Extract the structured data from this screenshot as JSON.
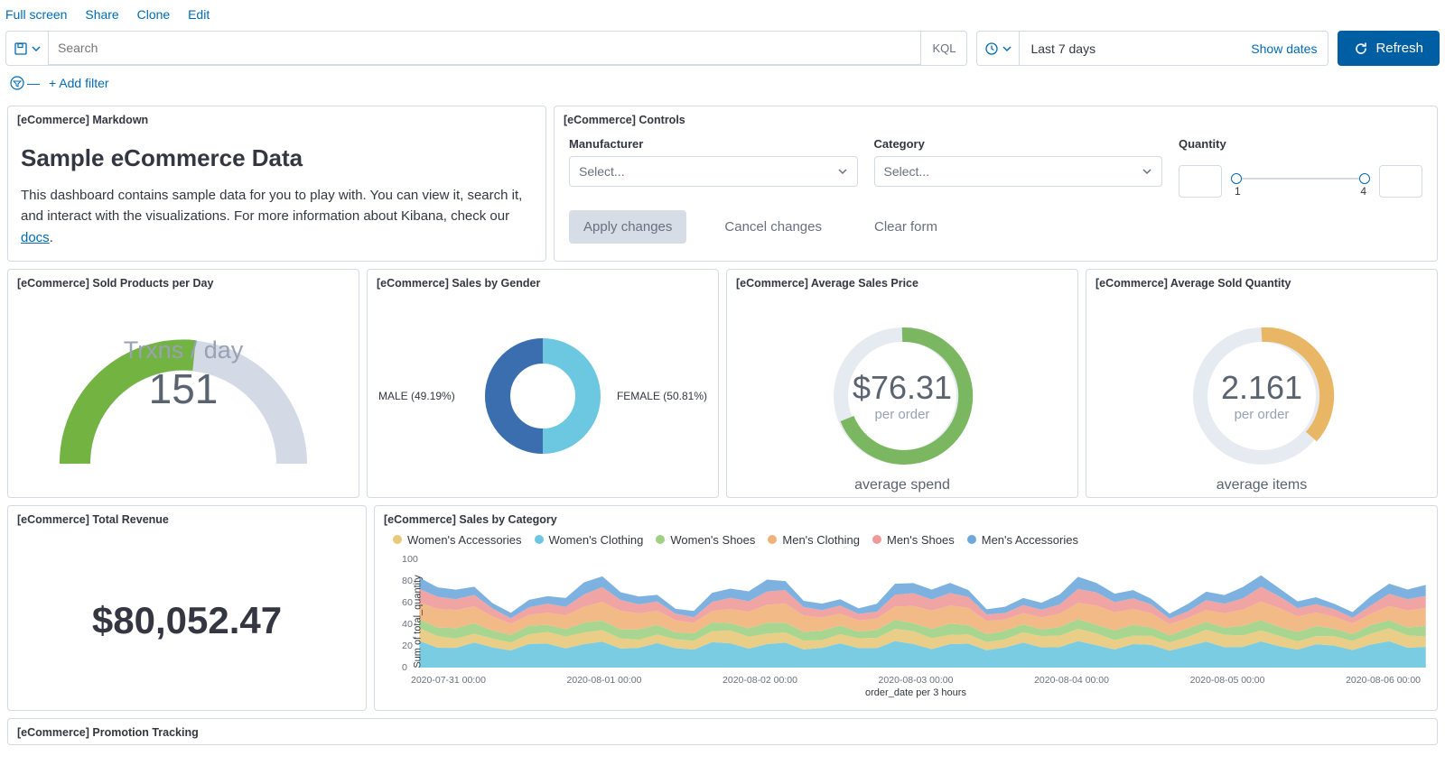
{
  "toolbar": {
    "links": [
      "Full screen",
      "Share",
      "Clone",
      "Edit"
    ],
    "search_placeholder": "Search",
    "kql": "KQL",
    "date_range": "Last 7 days",
    "show_dates": "Show dates",
    "refresh": "Refresh",
    "add_filter": "+ Add filter"
  },
  "panels": {
    "markdown": {
      "title": "[eCommerce] Markdown",
      "heading": "Sample eCommerce Data",
      "body_pre": "This dashboard contains sample data for you to play with. You can view it, search it, and interact with the visualizations. For more information about Kibana, check our ",
      "body_link": "docs",
      "body_post": "."
    },
    "controls": {
      "title": "[eCommerce] Controls",
      "manufacturer_label": "Manufacturer",
      "category_label": "Category",
      "quantity_label": "Quantity",
      "select_placeholder": "Select...",
      "range_min": "1",
      "range_max": "4",
      "apply": "Apply changes",
      "cancel": "Cancel changes",
      "clear": "Clear form"
    },
    "gauge": {
      "title": "[eCommerce] Sold Products per Day",
      "label": "Trxns / day",
      "value": "151"
    },
    "gender": {
      "title": "[eCommerce] Sales by Gender",
      "male_label": "MALE (49.19%)",
      "female_label": "FEMALE (50.81%)"
    },
    "avg_price": {
      "title": "[eCommerce] Average Sales Price",
      "value": "$76.31",
      "sub": "per order",
      "caption": "average spend"
    },
    "avg_qty": {
      "title": "[eCommerce] Average Sold Quantity",
      "value": "2.161",
      "sub": "per order",
      "caption": "average items"
    },
    "revenue": {
      "title": "[eCommerce] Total Revenue",
      "value": "$80,052.47"
    },
    "sales_cat": {
      "title": "[eCommerce] Sales by Category",
      "ylabel": "Sum of total_quantity",
      "xlabel": "order_date per 3 hours",
      "legend": [
        "Women's Accessories",
        "Women's Clothing",
        "Women's Shoes",
        "Men's Clothing",
        "Men's Shoes",
        "Men's Accessories"
      ],
      "colors": [
        "#e8c97a",
        "#6cc7e0",
        "#9fd184",
        "#f0b27a",
        "#ef9a9a",
        "#6fa8dc"
      ],
      "xticks": [
        "2020-07-31 00:00",
        "2020-08-01 00:00",
        "2020-08-02 00:00",
        "2020-08-03 00:00",
        "2020-08-04 00:00",
        "2020-08-05 00:00",
        "2020-08-06 00:00"
      ]
    },
    "promo": {
      "title": "[eCommerce] Promotion Tracking"
    }
  },
  "chart_data": [
    {
      "type": "bar",
      "panel": "gauge",
      "categories": [
        "Trxns / day"
      ],
      "values": [
        151
      ],
      "ylim": [
        0,
        300
      ],
      "title": "[eCommerce] Sold Products per Day"
    },
    {
      "type": "pie",
      "panel": "gender",
      "categories": [
        "FEMALE",
        "MALE"
      ],
      "values": [
        50.81,
        49.19
      ],
      "title": "[eCommerce] Sales by Gender"
    },
    {
      "type": "bar",
      "panel": "avg_price",
      "categories": [
        "average spend"
      ],
      "values": [
        76.31
      ],
      "ylim": [
        0,
        100
      ],
      "ylabel": "per order"
    },
    {
      "type": "bar",
      "panel": "avg_qty",
      "categories": [
        "average items"
      ],
      "values": [
        2.161
      ],
      "ylim": [
        0,
        4
      ],
      "ylabel": "per order"
    },
    {
      "type": "bar",
      "panel": "revenue",
      "categories": [
        "Total Revenue"
      ],
      "values": [
        80052.47
      ],
      "title": "[eCommerce] Total Revenue"
    },
    {
      "type": "area",
      "panel": "sales_cat",
      "title": "[eCommerce] Sales by Category",
      "xlabel": "order_date per 3 hours",
      "ylabel": "Sum of total_quantity",
      "ylim": [
        0,
        100
      ],
      "yticks": [
        0,
        20,
        40,
        60,
        80,
        100
      ],
      "x": [
        "2020-07-31 00:00",
        "2020-08-01 00:00",
        "2020-08-02 00:00",
        "2020-08-03 00:00",
        "2020-08-04 00:00",
        "2020-08-05 00:00",
        "2020-08-06 00:00"
      ],
      "series": [
        {
          "name": "Women's Accessories",
          "color": "#e8c97a"
        },
        {
          "name": "Women's Clothing",
          "color": "#6cc7e0"
        },
        {
          "name": "Women's Shoes",
          "color": "#9fd184"
        },
        {
          "name": "Men's Clothing",
          "color": "#f0b27a"
        },
        {
          "name": "Men's Shoes",
          "color": "#ef9a9a"
        },
        {
          "name": "Men's Accessories",
          "color": "#6fa8dc"
        }
      ],
      "note": "Stacked totals fluctuate roughly between 40 and 95 across 3-hour buckets; individual series values not directly labeled."
    }
  ]
}
